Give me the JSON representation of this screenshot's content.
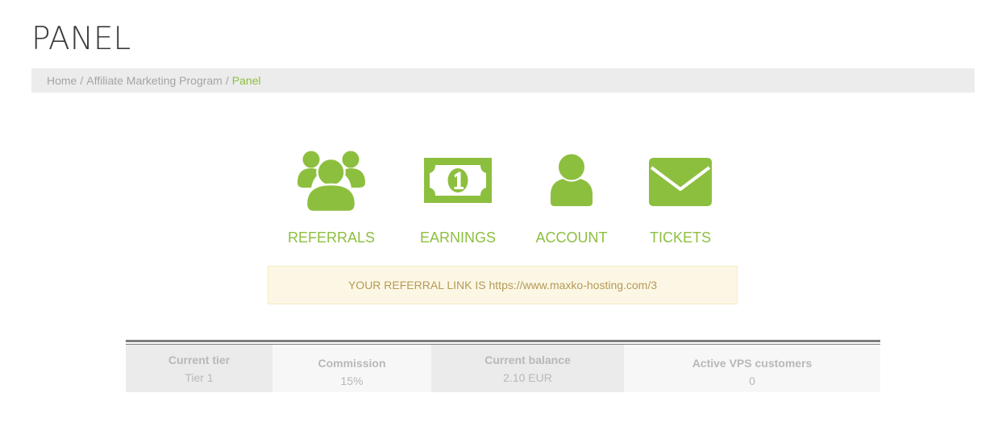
{
  "page": {
    "title": "PANEL"
  },
  "breadcrumb": {
    "items": [
      "Home",
      "Affiliate Marketing Program",
      "Panel"
    ],
    "separator": "/"
  },
  "nav_tiles": [
    {
      "label": "REFERRALS",
      "icon": "users-group-icon"
    },
    {
      "label": "EARNINGS",
      "icon": "banknote-icon"
    },
    {
      "label": "ACCOUNT",
      "icon": "user-icon"
    },
    {
      "label": "TICKETS",
      "icon": "envelope-icon"
    }
  ],
  "referral": {
    "prefix": "YOUR REFERRAL LINK IS",
    "link": "https://www.maxko-hosting.com/3"
  },
  "stats": [
    {
      "label": "Current tier",
      "value": "Tier 1"
    },
    {
      "label": "Commission",
      "value": "15%"
    },
    {
      "label": "Current balance",
      "value": "2.10 EUR"
    },
    {
      "label": "Active VPS customers",
      "value": "0"
    }
  ],
  "colors": {
    "accent": "#8dbf3f",
    "breadcrumb_bg": "#ececec",
    "alert_bg": "#fcf7e5",
    "alert_text": "#b59a57",
    "stat_text": "#b8b8b8"
  }
}
